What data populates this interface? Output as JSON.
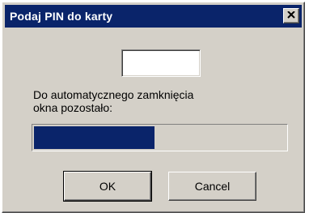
{
  "window": {
    "title": "Podaj PIN do karty",
    "close_icon": "close-icon"
  },
  "pin_input": {
    "value": ""
  },
  "message": {
    "line1": "Do automatycznego zamknięcia",
    "line2": "okna pozostało:"
  },
  "progress": {
    "fraction": 0.48
  },
  "buttons": {
    "ok_label": "OK",
    "cancel_label": "Cancel"
  },
  "colors": {
    "titlebar": "#0a246a",
    "progress_fill": "#0a246a",
    "dialog_face": "#d4d0c8"
  }
}
